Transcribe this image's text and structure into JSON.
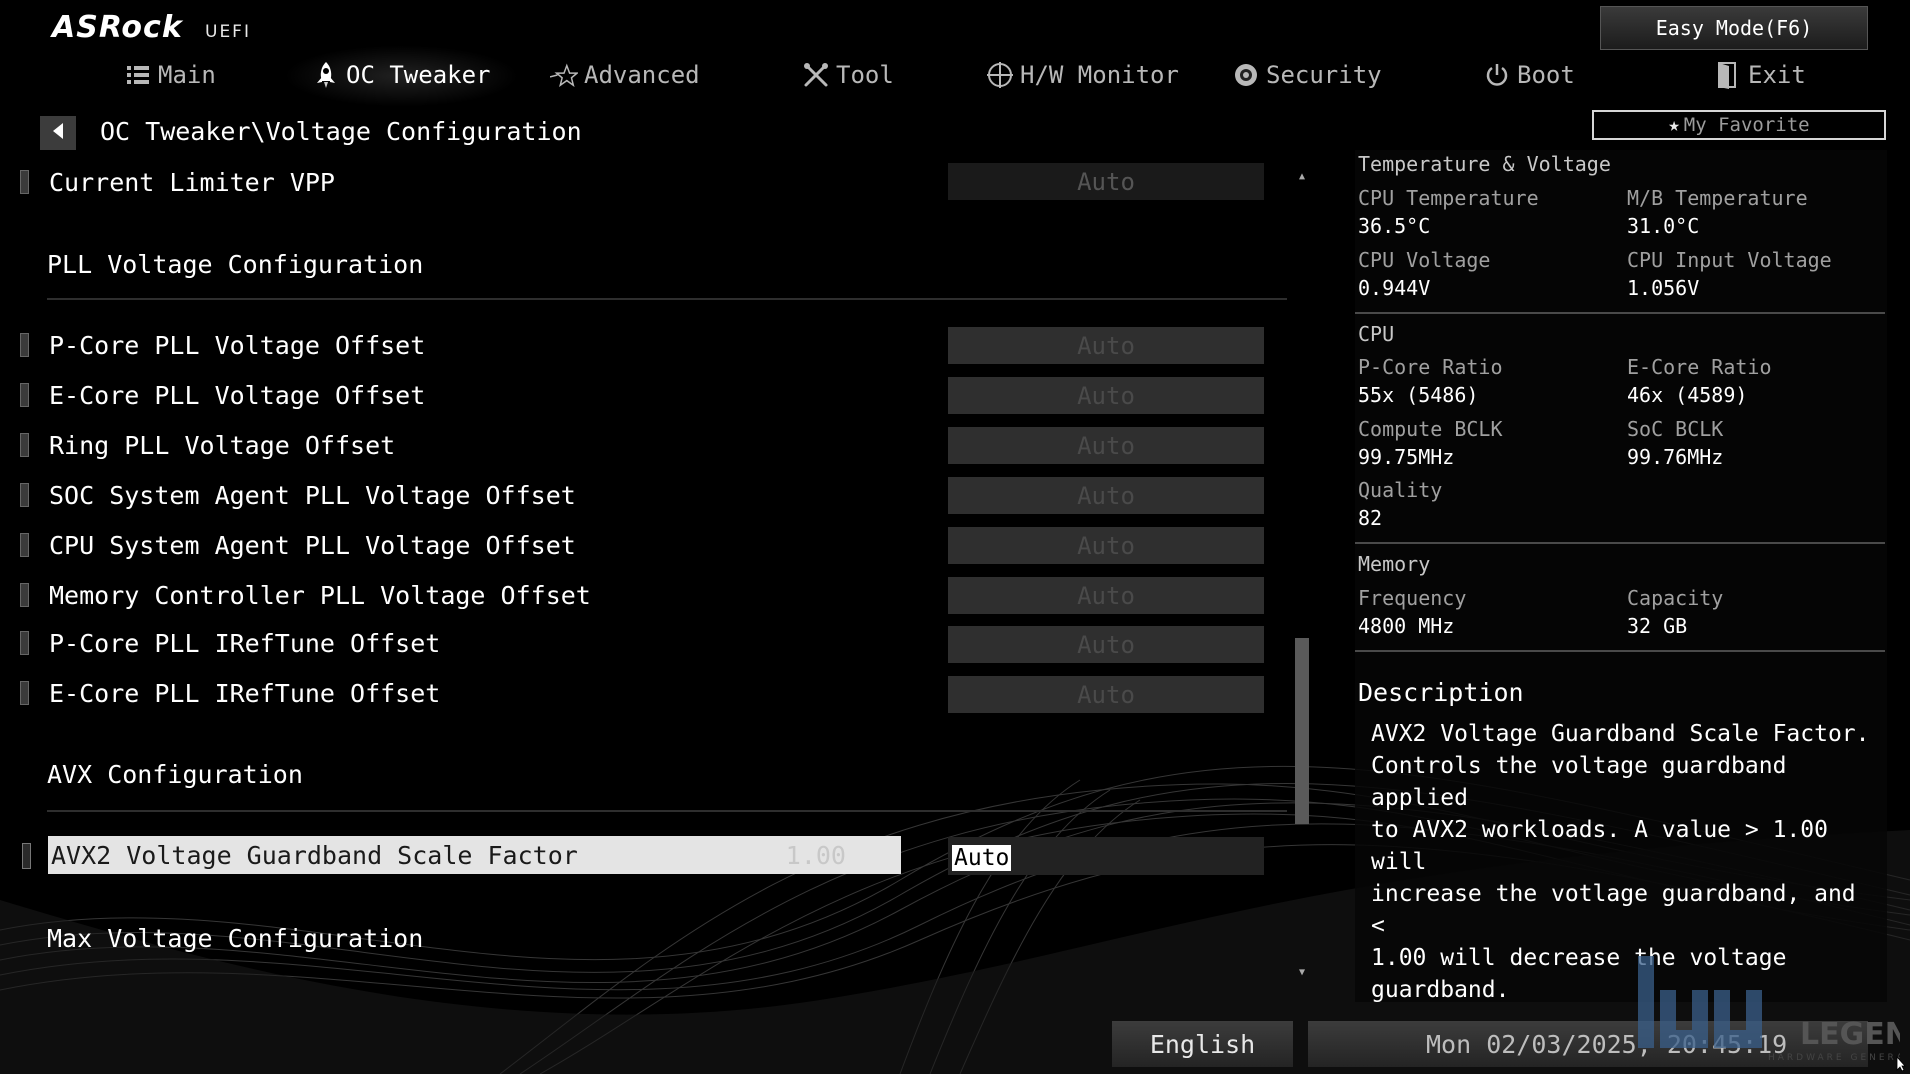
{
  "header": {
    "brand": "ASRock",
    "brand_sub": "UEFI",
    "easy_mode": "Easy Mode(F6)",
    "my_favorite": "My Favorite"
  },
  "nav": {
    "main": "Main",
    "oc_tweaker": "OC Tweaker",
    "advanced": "Advanced",
    "tool": "Tool",
    "hw_monitor": "H/W Monitor",
    "security": "Security",
    "boot": "Boot",
    "exit": "Exit"
  },
  "breadcrumb": "OC Tweaker\\Voltage Configuration",
  "settings": {
    "current_limiter_vpp": {
      "label": "Current Limiter VPP",
      "value": "Auto"
    },
    "pll_section": "PLL Voltage Configuration",
    "items": [
      {
        "label": "P-Core PLL Voltage Offset",
        "value": "Auto"
      },
      {
        "label": "E-Core PLL Voltage Offset",
        "value": "Auto"
      },
      {
        "label": "Ring PLL Voltage Offset",
        "value": "Auto"
      },
      {
        "label": "SOC System Agent PLL Voltage Offset",
        "value": "Auto"
      },
      {
        "label": "CPU System Agent PLL Voltage Offset",
        "value": "Auto"
      },
      {
        "label": "Memory Controller PLL Voltage Offset",
        "value": "Auto"
      },
      {
        "label": "P-Core PLL IRefTune Offset",
        "value": "Auto"
      },
      {
        "label": "E-Core PLL IRefTune Offset",
        "value": "Auto"
      }
    ],
    "avx_section": "AVX Configuration",
    "avx2_guardband": {
      "label": "AVX2 Voltage Guardband Scale Factor",
      "current": "1.00",
      "value": "Auto"
    },
    "max_voltage_section": "Max Voltage Configuration"
  },
  "panel": {
    "temp_voltage_title": "Temperature & Voltage",
    "cpu_temp_label": "CPU Temperature",
    "cpu_temp_value": "36.5°C",
    "mb_temp_label": "M/B Temperature",
    "mb_temp_value": "31.0°C",
    "cpu_voltage_label": "CPU Voltage",
    "cpu_voltage_value": "0.944V",
    "cpu_input_voltage_label": "CPU Input Voltage",
    "cpu_input_voltage_value": "1.056V",
    "cpu_title": "CPU",
    "pcore_ratio_label": "P-Core Ratio",
    "pcore_ratio_value": "55x (5486)",
    "ecore_ratio_label": "E-Core Ratio",
    "ecore_ratio_value": "46x (4589)",
    "compute_bclk_label": "Compute BCLK",
    "compute_bclk_value": "99.75MHz",
    "soc_bclk_label": "SoC BCLK",
    "soc_bclk_value": "99.76MHz",
    "quality_label": "Quality",
    "quality_value": "82",
    "memory_title": "Memory",
    "frequency_label": "Frequency",
    "frequency_value": "4800 MHz",
    "capacity_label": "Capacity",
    "capacity_value": "32 GB",
    "description_title": "Description",
    "description_body": "AVX2 Voltage Guardband Scale Factor.\nControls the voltage guardband applied\nto AVX2 workloads. A value > 1.00 will\nincrease the votlage guardband, and <\n1.00 will decrease the voltage\nguardband."
  },
  "footer": {
    "language": "English",
    "datetime": "Mon 02/03/2025, 20:45:19"
  },
  "watermark": {
    "text": "LEGEND",
    "sub": "HARDWARE GENERATION"
  },
  "colors": {
    "background": "#000000",
    "highlight": "#e4e4e4",
    "disabled_box": "#2f2f2f"
  },
  "icons": {
    "main": "list-icon",
    "oc_tweaker": "rocket-icon",
    "advanced": "star-icon",
    "tool": "tools-icon",
    "hw_monitor": "crosshair-icon",
    "security": "shield-icon",
    "boot": "power-icon",
    "exit": "door-icon",
    "favorite": "star-icon",
    "back": "back-arrow-icon"
  }
}
